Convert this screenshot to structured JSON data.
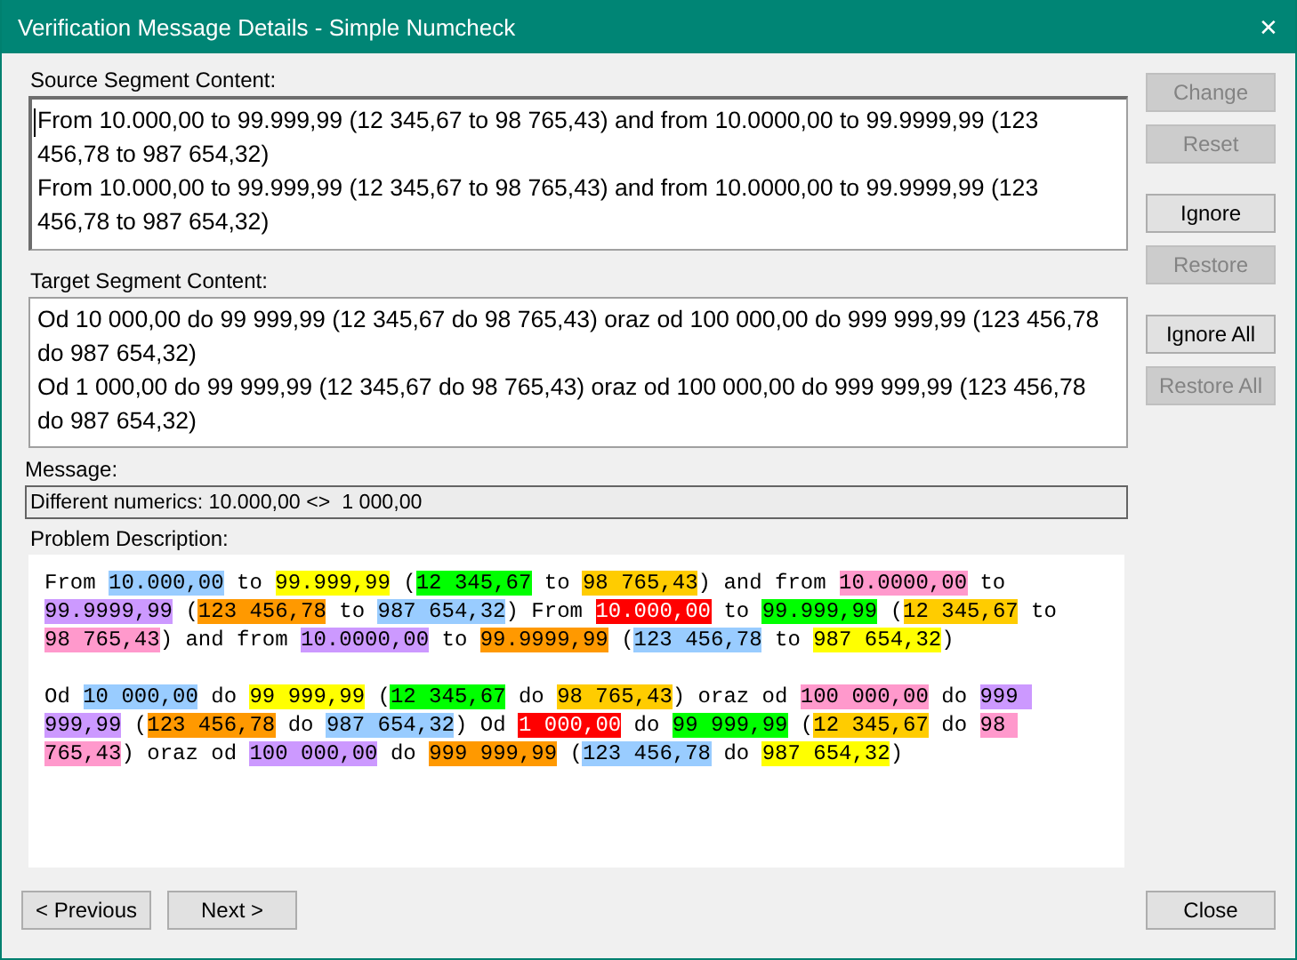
{
  "window": {
    "title": "Verification Message Details - Simple Numcheck",
    "close": "✕"
  },
  "source": {
    "label": "Source Segment Content:",
    "lines": [
      "From 10.000,00 to 99.999,99 (12 345,67 to 98 765,43) and from 10.0000,00 to 99.9999,99 (123 456,78 to 987 654,32)",
      "From 10.000,00 to 99.999,99 (12 345,67 to 98 765,43) and from 10.0000,00 to 99.9999,99 (123 456,78 to 987 654,32)"
    ]
  },
  "target": {
    "label": "Target Segment Content:",
    "lines": [
      "Od 10 000,00 do 99 999,99 (12 345,67 do 98 765,43) oraz od 100 000,00 do 999 999,99 (123 456,78 do 987 654,32)",
      "Od 1 000,00 do 99 999,99 (12 345,67 do 98 765,43) oraz od 100 000,00 do 999 999,99 (123 456,78 do 987 654,32)"
    ]
  },
  "message": {
    "label": "Message:",
    "value": "Different numerics: 10.000,00 <>  1 000,00"
  },
  "problem": {
    "label": "Problem Description:",
    "paragraphs": [
      {
        "segments": [
          {
            "text": "From "
          },
          {
            "text": "10.000,00",
            "color": "#99ccff"
          },
          {
            "text": " to "
          },
          {
            "text": "99.999,99",
            "color": "#ffff00"
          },
          {
            "text": " ("
          },
          {
            "text": "12 345,67",
            "color": "#00ff00"
          },
          {
            "text": " to "
          },
          {
            "text": "98 765,43",
            "color": "#ffcc00"
          },
          {
            "text": ") and from "
          },
          {
            "text": "10.0000,00",
            "color": "#ff99cc"
          },
          {
            "text": " to "
          },
          {
            "text": "99.9999,99",
            "color": "#cc99ff"
          },
          {
            "text": " ("
          },
          {
            "text": "123 456,78",
            "color": "#ff9900"
          },
          {
            "text": " to "
          },
          {
            "text": "987 654,32",
            "color": "#99ccff"
          },
          {
            "text": ") From "
          },
          {
            "text": "10.000,00",
            "color": "#ff0000"
          },
          {
            "text": " to "
          },
          {
            "text": "99.999,99",
            "color": "#00ff00"
          },
          {
            "text": " ("
          },
          {
            "text": "12 345,67",
            "color": "#ffcc00"
          },
          {
            "text": " to "
          },
          {
            "text": "98 765,43",
            "color": "#ff99cc"
          },
          {
            "text": ") and from "
          },
          {
            "text": "10.0000,00",
            "color": "#cc99ff"
          },
          {
            "text": " to "
          },
          {
            "text": "99.9999,99",
            "color": "#ff9900"
          },
          {
            "text": " ("
          },
          {
            "text": "123 456,78",
            "color": "#99ccff"
          },
          {
            "text": " to "
          },
          {
            "text": "987 654,32",
            "color": "#ffff00"
          },
          {
            "text": ")"
          }
        ]
      },
      {
        "segments": [
          {
            "text": "Od "
          },
          {
            "text": "10 000,00",
            "color": "#99ccff"
          },
          {
            "text": " do "
          },
          {
            "text": "99 999,99",
            "color": "#ffff00"
          },
          {
            "text": " ("
          },
          {
            "text": "12 345,67",
            "color": "#00ff00"
          },
          {
            "text": " do "
          },
          {
            "text": "98 765,43",
            "color": "#ffcc00"
          },
          {
            "text": ") oraz od "
          },
          {
            "text": "100 000,00",
            "color": "#ff99cc"
          },
          {
            "text": " do "
          },
          {
            "text": "999 999,99",
            "color": "#cc99ff"
          },
          {
            "text": " ("
          },
          {
            "text": "123 456,78",
            "color": "#ff9900"
          },
          {
            "text": " do "
          },
          {
            "text": "987 654,32",
            "color": "#99ccff"
          },
          {
            "text": ") Od "
          },
          {
            "text": "1 000,00",
            "color": "#ff0000"
          },
          {
            "text": " do "
          },
          {
            "text": "99 999,99",
            "color": "#00ff00"
          },
          {
            "text": " ("
          },
          {
            "text": "12 345,67",
            "color": "#ffcc00"
          },
          {
            "text": " do "
          },
          {
            "text": "98 765,43",
            "color": "#ff99cc"
          },
          {
            "text": ") oraz od "
          },
          {
            "text": "100 000,00",
            "color": "#cc99ff"
          },
          {
            "text": " do "
          },
          {
            "text": "999 999,99",
            "color": "#ff9900"
          },
          {
            "text": " ("
          },
          {
            "text": "123 456,78",
            "color": "#99ccff"
          },
          {
            "text": " do "
          },
          {
            "text": "987 654,32",
            "color": "#ffff00"
          },
          {
            "text": ")"
          }
        ]
      }
    ]
  },
  "side_buttons": [
    {
      "label": "Change",
      "disabled": true
    },
    {
      "label": "Reset",
      "disabled": true
    },
    {
      "label": "Ignore",
      "disabled": false
    },
    {
      "label": "Restore",
      "disabled": true
    },
    {
      "label": "Ignore All",
      "disabled": false
    },
    {
      "label": "Restore All",
      "disabled": true
    }
  ],
  "bottom_buttons": [
    {
      "label": "< Previous",
      "disabled": false
    },
    {
      "label": "Next >",
      "disabled": false
    },
    {
      "label": "Close",
      "disabled": false
    }
  ]
}
